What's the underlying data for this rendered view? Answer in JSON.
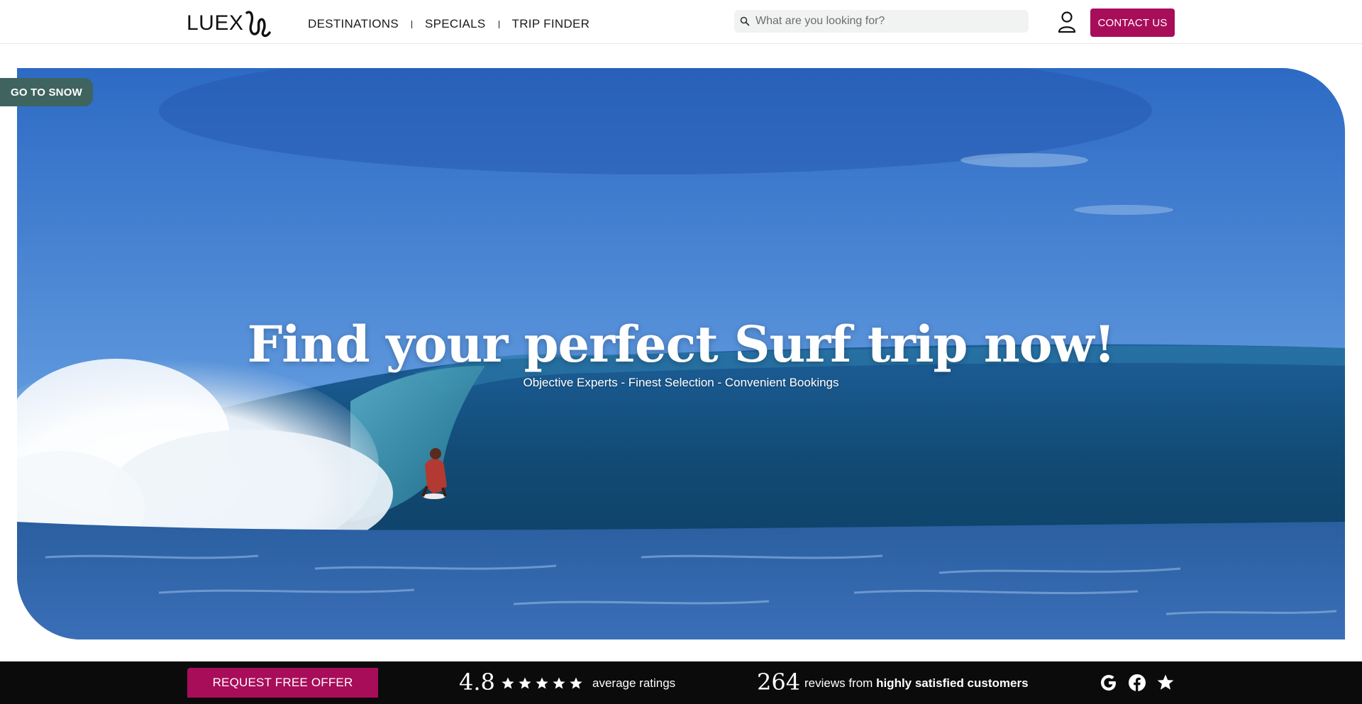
{
  "header": {
    "logo_text": "LUEX",
    "nav": [
      {
        "label": "DESTINATIONS"
      },
      {
        "label": "SPECIALS"
      },
      {
        "label": "TRIP FINDER"
      }
    ],
    "search": {
      "placeholder": "What are you looking for?",
      "value": ""
    },
    "contact_label": "CONTACT US"
  },
  "side_tab": {
    "label": "GO TO SNOW"
  },
  "hero": {
    "title": "Find your perfect Surf trip now!",
    "subtitle": "Objective Experts - Finest Selection - Convenient Bookings"
  },
  "bottom_bar": {
    "request_label": "REQUEST FREE OFFER",
    "rating_value": "4.8",
    "rating_stars": 5,
    "rating_label": "average ratings",
    "reviews_count": "264",
    "reviews_label_prefix": "reviews from ",
    "reviews_label_strong": "highly satisfied customers",
    "social_icons": [
      "google-icon",
      "facebook-icon",
      "star-icon"
    ]
  },
  "colors": {
    "brand": "#a80d5a",
    "snow_tab": "#3f6460",
    "bottom_bar": "#0b0b0b"
  }
}
